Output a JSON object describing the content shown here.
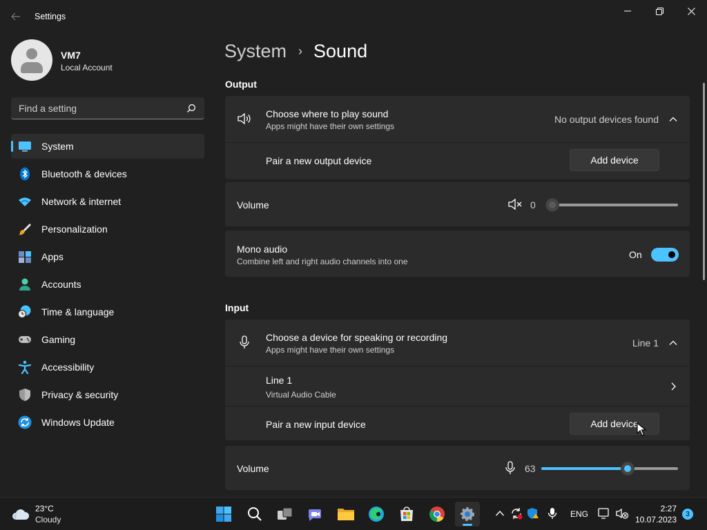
{
  "window": {
    "title": "Settings",
    "back_icon": "arrow-left-icon",
    "controls": [
      "minimize-icon",
      "maximize-icon",
      "close-icon"
    ]
  },
  "user": {
    "name": "VM7",
    "account_type": "Local Account"
  },
  "search": {
    "placeholder": "Find a setting",
    "value": ""
  },
  "sidebar": {
    "items": [
      {
        "label": "System",
        "icon": "system-monitor-icon",
        "active": true
      },
      {
        "label": "Bluetooth & devices",
        "icon": "bluetooth-icon"
      },
      {
        "label": "Network & internet",
        "icon": "wifi-icon"
      },
      {
        "label": "Personalization",
        "icon": "paintbrush-icon"
      },
      {
        "label": "Apps",
        "icon": "apps-grid-icon"
      },
      {
        "label": "Accounts",
        "icon": "person-icon"
      },
      {
        "label": "Time & language",
        "icon": "globe-clock-icon"
      },
      {
        "label": "Gaming",
        "icon": "game-controller-icon"
      },
      {
        "label": "Accessibility",
        "icon": "accessibility-icon"
      },
      {
        "label": "Privacy & security",
        "icon": "shield-icon"
      },
      {
        "label": "Windows Update",
        "icon": "windows-update-icon"
      }
    ]
  },
  "breadcrumb": {
    "parent": "System",
    "separator": "›",
    "current": "Sound"
  },
  "output": {
    "section_title": "Output",
    "choose": {
      "title": "Choose where to play sound",
      "subtitle": "Apps might have their own settings",
      "value": "No output devices found",
      "icon": "speaker-icon"
    },
    "pair": {
      "label": "Pair a new output device",
      "button": "Add device"
    },
    "volume": {
      "label": "Volume",
      "value": "0",
      "level": 0,
      "icon": "speaker-muted-icon"
    },
    "mono": {
      "title": "Mono audio",
      "subtitle": "Combine left and right audio channels into one",
      "state": "On",
      "enabled": true
    }
  },
  "input": {
    "section_title": "Input",
    "choose": {
      "title": "Choose a device for speaking or recording",
      "subtitle": "Apps might have their own settings",
      "value": "Line 1",
      "icon": "microphone-icon"
    },
    "device": {
      "name": "Line 1",
      "description": "Virtual Audio Cable"
    },
    "pair": {
      "label": "Pair a new input device",
      "button": "Add device"
    },
    "volume": {
      "label": "Volume",
      "value": "63",
      "level": 63,
      "icon": "microphone-icon"
    }
  },
  "taskbar": {
    "weather": {
      "temp": "23°C",
      "condition": "Cloudy",
      "icon": "cloud-icon"
    },
    "apps": [
      "start-icon",
      "search-icon",
      "task-view-icon",
      "teams-chat-icon",
      "file-explorer-icon",
      "edge-icon",
      "store-icon",
      "chrome-icon",
      "settings-icon"
    ],
    "tray": [
      "chevron-up-icon",
      "sync-icon",
      "defender-warning-icon",
      "microphone-icon"
    ],
    "language": "ENG",
    "time": "2:27",
    "date": "10.07.2023",
    "notifications": "3"
  },
  "colors": {
    "accent": "#4cc2ff",
    "background": "#202020",
    "card": "#2b2b2b"
  }
}
